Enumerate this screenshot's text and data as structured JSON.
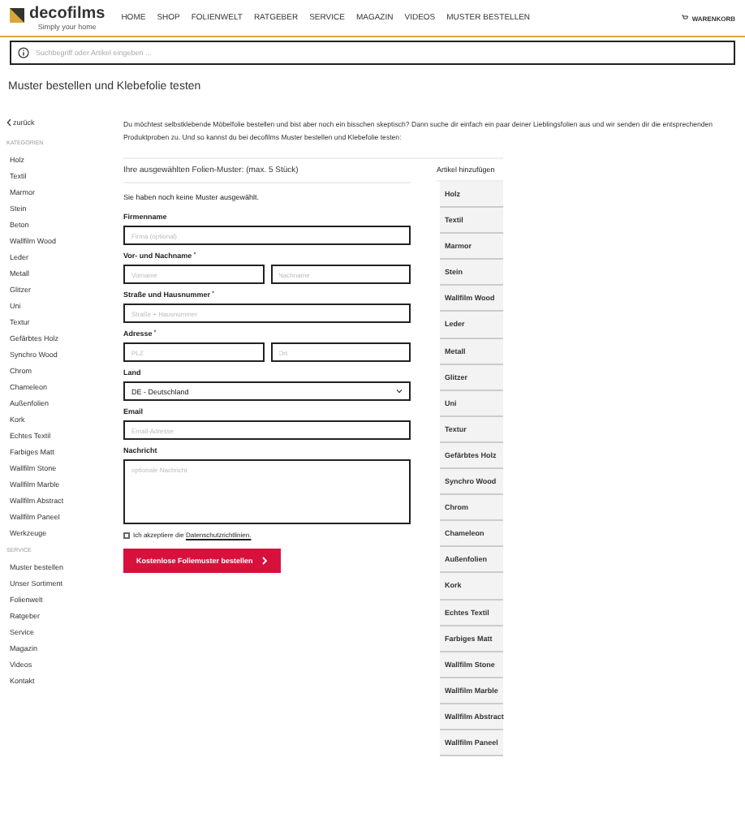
{
  "header": {
    "logo": "decofilms",
    "tagline": "Simply your home",
    "nav": [
      "HOME",
      "SHOP",
      "FOLIENWELT",
      "RATGEBER",
      "SERVICE",
      "MAGAZIN",
      "VIDEOS",
      "MUSTER BESTELLEN"
    ],
    "cart": "WARENKORB"
  },
  "search": {
    "placeholder": "Suchbegriff oder Artikel eingeben ..."
  },
  "page_title": "Muster bestellen und Klebefolie testen",
  "back_link": "zurück",
  "sidebar": {
    "sections": [
      {
        "heading": "KATEGORIEN",
        "items": [
          "Holz",
          "Textil",
          "Marmor",
          "Stein",
          "Beton",
          "Wallfilm Wood",
          "Leder",
          "Metall",
          "Glitzer",
          "Uni",
          "Textur",
          "Gefärbtes Holz",
          "Synchro Wood",
          "Chrom",
          "Chameleon",
          "Außenfolien",
          "Kork",
          "Echtes Textil",
          "Farbiges Matt",
          "Wallfilm Stone",
          "Wallfilm Marble",
          "Wallfilm Abstract",
          "Wallfilm Paneel",
          "Werkzeuge"
        ]
      },
      {
        "heading": "SERVICE",
        "items": [
          "Muster bestellen",
          "Unser Sortiment",
          "Folienwelt",
          "Ratgeber",
          "Service",
          "Magazin",
          "Videos",
          "Kontakt"
        ]
      }
    ]
  },
  "intro": "Du möchtest selbstklebende Möbelfolie bestellen und bist aber noch ein bisschen skeptisch? Dann suche dir einfach ein paar deiner Lieblingsfolien aus und wir senden dir die entsprechenden Produktproben zu. Und so kannst du bei decofilms Muster bestellen und Klebefolie testen:",
  "selection": {
    "heading": "Ihre ausgewählten Folien-Muster: (max. 5 Stück)",
    "empty_text": "Sie haben noch keine Muster ausgewählt."
  },
  "form": {
    "fields": [
      {
        "kind": "text",
        "label": "Firmenname",
        "placeholders": [
          "Firma (optional)"
        ]
      },
      {
        "kind": "pair",
        "label": "Vor- und Nachname",
        "required_mark": "*",
        "placeholders": [
          "Vorname",
          "Nachname"
        ]
      },
      {
        "kind": "text",
        "label": "Straße und Hausnummer",
        "required_mark": "*",
        "placeholders": [
          "Straße + Hausnummer"
        ]
      },
      {
        "kind": "pair",
        "label": "Adresse",
        "required_mark": "*",
        "placeholders": [
          "PLZ",
          "Ort"
        ]
      },
      {
        "kind": "select",
        "label": "Land",
        "value": "DE - Deutschland"
      },
      {
        "kind": "text",
        "label": "Email",
        "placeholders": [
          "Email-Adresse"
        ]
      },
      {
        "kind": "textarea",
        "label": "Nachricht",
        "placeholders": [
          "optionale Nachricht"
        ]
      }
    ],
    "consent": {
      "checked": false,
      "text": "Ich akzeptiere die",
      "link": "Datenschutzrichtlinien."
    },
    "submit": "Kostenlose Foliemuster bestellen"
  },
  "add_panel": {
    "heading": "Artikel hinzufügen",
    "items": [
      "Holz",
      "Textil",
      "Marmor",
      "Stein",
      "Wallfilm Wood",
      "Leder",
      "Metall",
      "Glitzer",
      "Uni",
      "Textur",
      "Gefärbtes Holz",
      "Synchro Wood",
      "Chrom",
      "Chameleon",
      "Außenfolien",
      "Kork",
      "Echtes Textil",
      "Farbiges Matt",
      "Wallfilm Stone",
      "Wallfilm Marble",
      "Wallfilm Abstract",
      "Wallfilm Paneel"
    ]
  }
}
